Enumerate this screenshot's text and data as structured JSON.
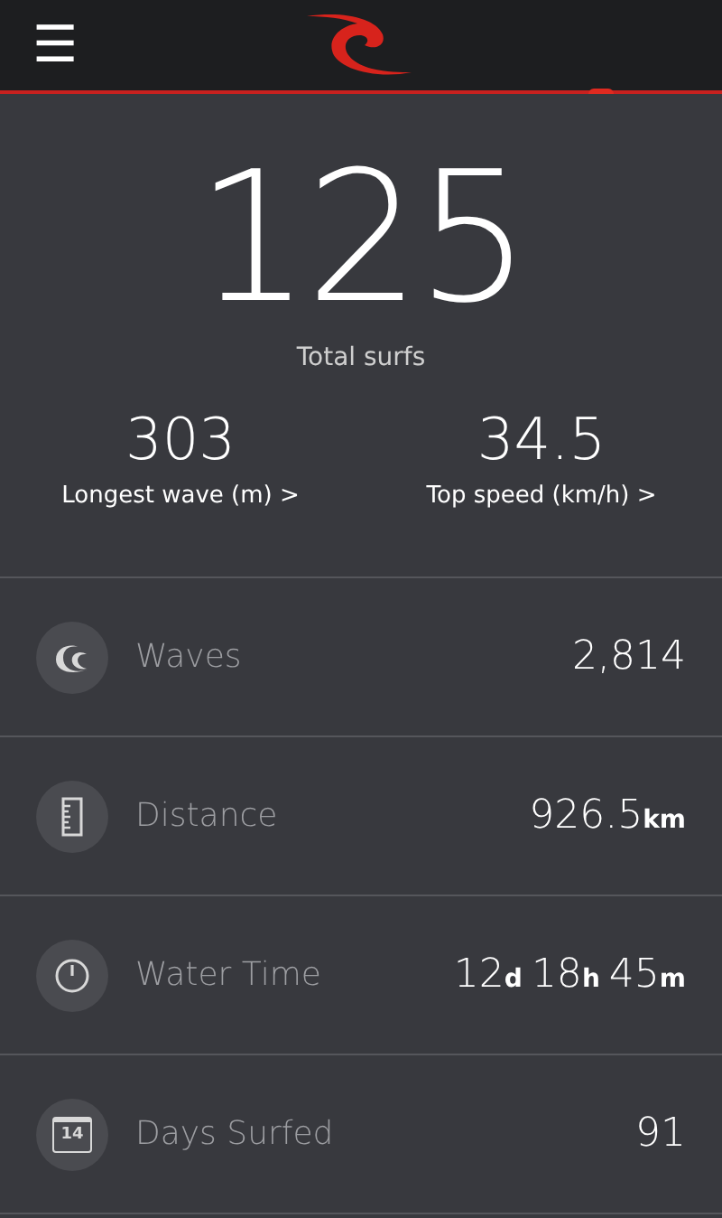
{
  "header": {
    "menu": "☰"
  },
  "summary": {
    "total": "125",
    "total_label": "Total surfs",
    "stats": [
      {
        "value": "303",
        "label": "Longest wave (m) >"
      },
      {
        "value": "34.5",
        "label": "Top speed (km/h) >"
      }
    ]
  },
  "rows": [
    {
      "kind": "wave",
      "label": "Waves",
      "value": [
        {
          "number": "2,814"
        }
      ]
    },
    {
      "kind": "ruler",
      "label": "Distance",
      "value": [
        {
          "number": "926.5",
          "unit": "km"
        }
      ]
    },
    {
      "kind": "timer",
      "label": "Water Time",
      "value": [
        {
          "number": "12",
          "unit": "d"
        },
        {
          "number": "18",
          "unit": "h"
        },
        {
          "number": "45",
          "unit": "m"
        }
      ]
    },
    {
      "kind": "calendar",
      "label": "Days Surfed",
      "icon_text": "14",
      "value": [
        {
          "number": "91"
        }
      ]
    }
  ]
}
